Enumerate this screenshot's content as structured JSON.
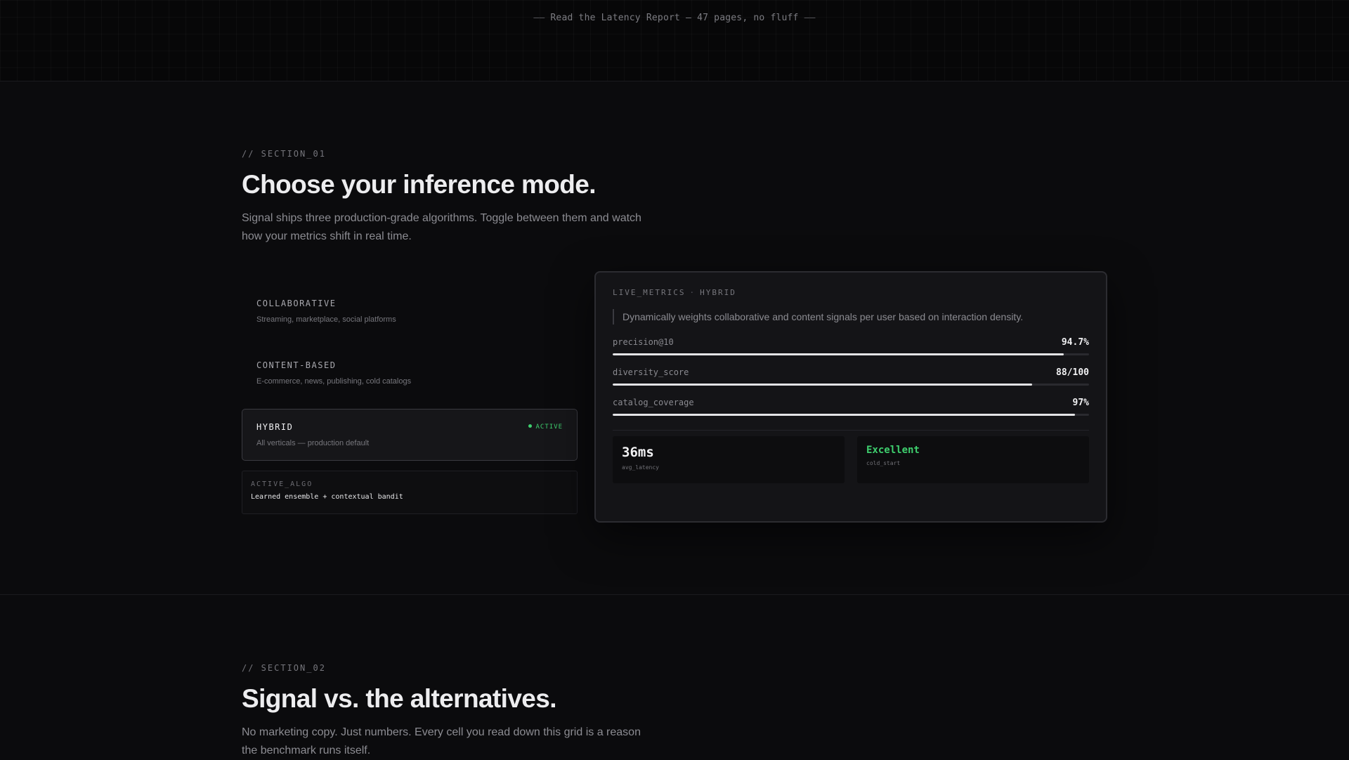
{
  "banner": {
    "dash_left": "——",
    "text": "Read the Latency Report — 47 pages, no fluff",
    "dash_right": "——"
  },
  "section1": {
    "eyebrow": "// SECTION_01",
    "title": "Choose your inference mode.",
    "subtitle": "Signal ships three production-grade algorithms. Toggle between them and watch how your metrics shift in real time.",
    "algorithms": [
      {
        "name": "COLLABORATIVE",
        "desc": "Streaming, marketplace, social platforms",
        "active": false
      },
      {
        "name": "CONTENT-BASED",
        "desc": "E-commerce, news, publishing, cold catalogs",
        "active": false
      },
      {
        "name": "HYBRID",
        "desc": "All verticals — production default",
        "active": true
      }
    ],
    "active_badge": "ACTIVE",
    "active_algo": {
      "label": "ACTIVE_ALGO",
      "value": "Learned ensemble + contextual bandit"
    },
    "panel": {
      "heading_left": "LIVE_METRICS",
      "heading_sep": "·",
      "heading_right": "HYBRID",
      "quote": "Dynamically weights collaborative and content signals per user based on interaction density.",
      "metrics": [
        {
          "name": "precision@10",
          "value": "94.7%",
          "fraction": 0.947
        },
        {
          "name": "diversity_score",
          "value": "88/100",
          "fraction": 0.88
        },
        {
          "name": "catalog_coverage",
          "value": "97%",
          "fraction": 0.97
        }
      ],
      "stats": [
        {
          "value": "36ms",
          "caption": "avg_latency"
        },
        {
          "value": "Excellent",
          "caption": "cold_start"
        }
      ],
      "colors": {
        "accent_green": "#3ecf6e"
      }
    }
  },
  "section2": {
    "eyebrow": "// SECTION_02",
    "title": "Signal vs. the alternatives.",
    "subtitle": "No marketing copy. Just numbers. Every cell you read down this grid is a reason the benchmark runs itself."
  }
}
